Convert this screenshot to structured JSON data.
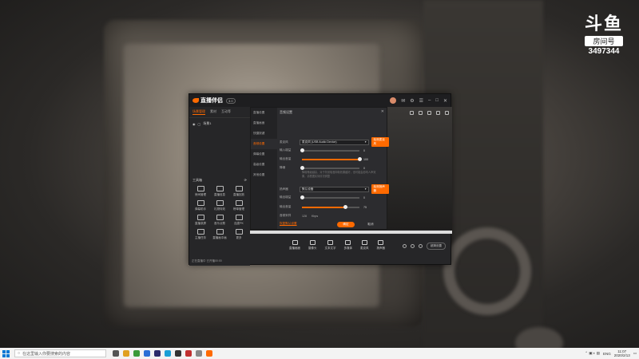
{
  "overlay": {
    "logo_mark": "斗鱼",
    "room_label": "房间号",
    "room_number": "3497344"
  },
  "app": {
    "name": "直播伴侣",
    "version": "3.0"
  },
  "left_panel": {
    "tabs": [
      "场景管理",
      "素材",
      "互动等"
    ],
    "scene_name": "场景1",
    "tools_title": "工具箱",
    "tools": [
      "房间管理",
      "直播信息",
      "直播回放",
      "弹幕助手",
      "礼物特效",
      "榜单管理",
      "直播录屏",
      "音乐点歌",
      "连麦PK",
      "主播任务",
      "直播画中画",
      "更多"
    ],
    "status": "正在直播中 已开播00:00"
  },
  "settings": {
    "title": "音频设置",
    "nav": [
      "直播设置",
      "直播画面",
      "快捷按键",
      "音频设置",
      "弹幕设置",
      "高级设置",
      "其他设置"
    ],
    "active_index": 3,
    "mic_label": "麦克风",
    "mic_device": "麦克风 (USB Audio Device)",
    "mic_button": "检测麦克风",
    "input_volume_label": "输入增益",
    "input_volume": "0",
    "input_volume_level": 0,
    "output_volume_label": "输出音量",
    "output_volume": "100",
    "output_volume_level": 100,
    "noise_label": "降噪",
    "noise_value": "0",
    "noise_level": 0,
    "noise_desc": "降噪等级越高，对于背景噪音抑制效果越好，但可能会影响人声效果，请根据实际情况调整",
    "speaker_label": "扬声器",
    "speaker_device": "默认设备",
    "speaker_button": "检测扬声器",
    "speaker_gain_label": "输出增益",
    "speaker_gain": "0",
    "speaker_gain_level": 0,
    "speaker_volume_label": "输出音量",
    "speaker_volume": "75",
    "speaker_volume_level": 75,
    "sample_label": "音频采样",
    "sample_values": [
      "128",
      "Kbps"
    ],
    "restore": "恢复默认设置",
    "confirm": "确定",
    "cancel": "取消"
  },
  "toolbar": {
    "buttons": [
      "直播画面",
      "摄像头",
      "文本文字",
      "多媒体",
      "麦克风",
      "扬声器"
    ],
    "quality": "超清设置"
  },
  "taskbar": {
    "search_placeholder": "在这里输入你要搜索的内容",
    "lang": "ENG",
    "time": "11:07",
    "date": "2020/2/13"
  }
}
